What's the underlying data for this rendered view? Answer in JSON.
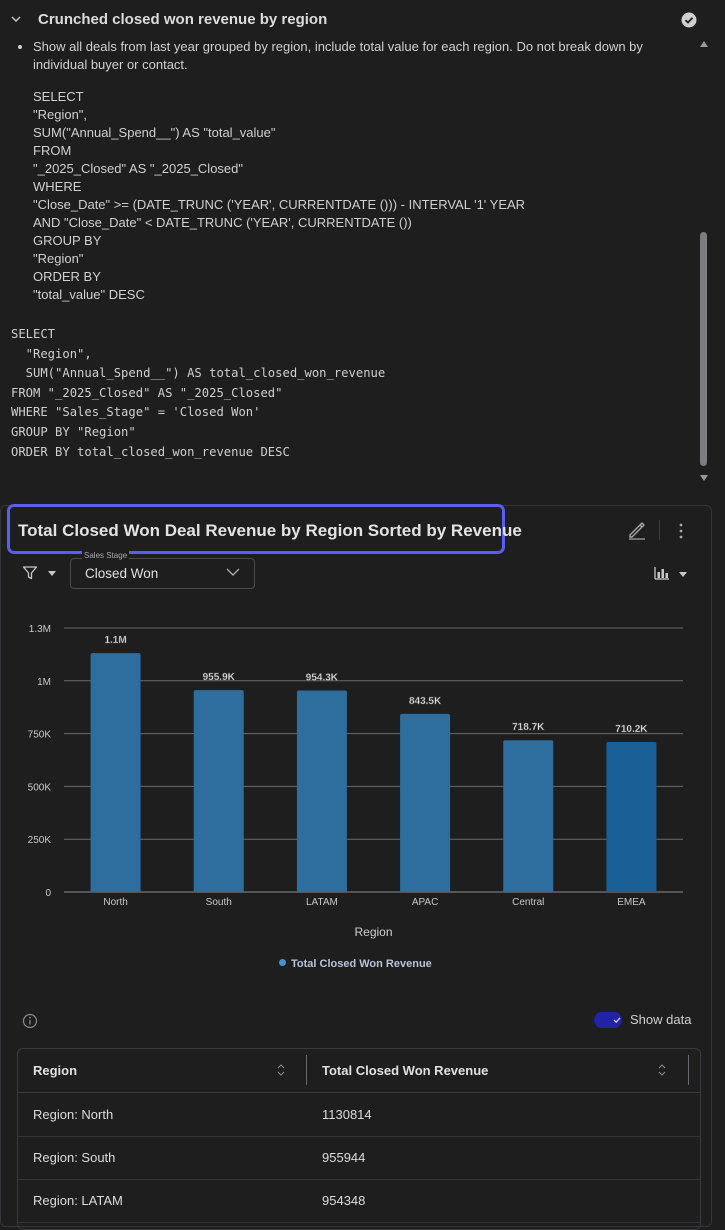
{
  "section": {
    "title": "Crunched closed won revenue by region",
    "prompt": "Show all deals from last year grouped by region, include total value for each region. Do not break down by individual buyer or contact.",
    "prompt_sql": "SELECT\n\"Region\",\nSUM(\"Annual_Spend__\") AS \"total_value\"\nFROM\n\"_2025_Closed\" AS \"_2025_Closed\"\nWHERE\n\"Close_Date\" >= (DATE_TRUNC ('YEAR', CURRENTDATE ())) - INTERVAL '1' YEAR\nAND \"Close_Date\" < DATE_TRUNC ('YEAR', CURRENTDATE ())\nGROUP BY\n\"Region\"\nORDER BY\n\"total_value\" DESC",
    "sql": "SELECT\n  \"Region\",\n  SUM(\"Annual_Spend__\") AS total_closed_won_revenue\nFROM \"_2025_Closed\" AS \"_2025_Closed\"\nWHERE \"Sales_Stage\" = 'Closed Won'\nGROUP BY \"Region\"\nORDER BY total_closed_won_revenue DESC"
  },
  "card": {
    "title": "Total Closed Won Deal Revenue by Region Sorted by Revenue",
    "filter_label": "Sales Stage",
    "filter_value": "Closed Won",
    "show_data_label": "Show data"
  },
  "icons": {
    "collapse": "chevron-down-icon",
    "status": "check-circle-icon",
    "edit": "pencil-icon",
    "more": "more-vertical-icon",
    "filter": "filter-icon",
    "chart_type": "bar-chart-icon",
    "info": "info-icon"
  },
  "colors": {
    "accent_outline": "#5b5cf0",
    "bar": "#2d6e9e",
    "bar_highlight": "#1a5f96",
    "toggle": "#2222a8"
  },
  "chart_data": {
    "type": "bar",
    "categories": [
      "North",
      "South",
      "LATAM",
      "APAC",
      "Central",
      "EMEA"
    ],
    "series": [
      {
        "name": "Total Closed Won Revenue",
        "values": [
          1130814,
          955944,
          954348,
          843500,
          718700,
          710200
        ]
      }
    ],
    "data_labels": [
      "1.1M",
      "955.9K",
      "954.3K",
      "843.5K",
      "718.7K",
      "710.2K"
    ],
    "xlabel": "Region",
    "ylabel": "",
    "ylim": [
      0,
      1250000
    ],
    "yticks": [
      0,
      250000,
      500000,
      750000,
      1000000,
      1250000
    ],
    "ytick_labels": [
      "0",
      "250K",
      "500K",
      "750K",
      "1M",
      "1.3M"
    ],
    "grid": true,
    "legend": "bottom"
  },
  "table": {
    "headers": [
      "Region",
      "Total Closed Won Revenue"
    ],
    "rows": [
      [
        "Region: North",
        "1130814"
      ],
      [
        "Region: South",
        "955944"
      ],
      [
        "Region: LATAM",
        "954348"
      ]
    ]
  }
}
